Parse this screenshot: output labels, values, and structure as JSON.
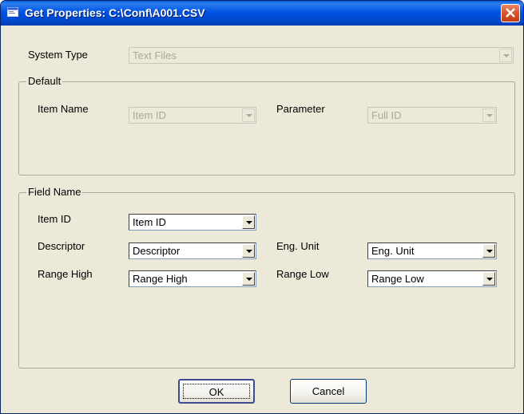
{
  "window": {
    "title": "Get Properties: C:\\Conf\\A001.CSV"
  },
  "system_type": {
    "label": "System Type",
    "value": "Text Files"
  },
  "default_group": {
    "title": "Default",
    "item_name": {
      "label": "Item Name",
      "value": "Item ID"
    },
    "parameter": {
      "label": "Parameter",
      "value": "Full ID"
    }
  },
  "field_name_group": {
    "title": "Field Name",
    "item_id": {
      "label": "Item ID",
      "value": "Item ID"
    },
    "descriptor": {
      "label": "Descriptor",
      "value": "Descriptor"
    },
    "eng_unit": {
      "label": "Eng. Unit",
      "value": "Eng. Unit"
    },
    "range_high": {
      "label": "Range High",
      "value": "Range High"
    },
    "range_low": {
      "label": "Range Low",
      "value": "Range Low"
    }
  },
  "buttons": {
    "ok": "OK",
    "cancel": "Cancel"
  },
  "icons": {
    "title": "app-window-icon",
    "close": "close-icon",
    "dropdown": "chevron-down-icon"
  },
  "colors": {
    "titlebar": "#0054e3",
    "close": "#d8542a",
    "dialog_bg": "#ece9d8"
  }
}
